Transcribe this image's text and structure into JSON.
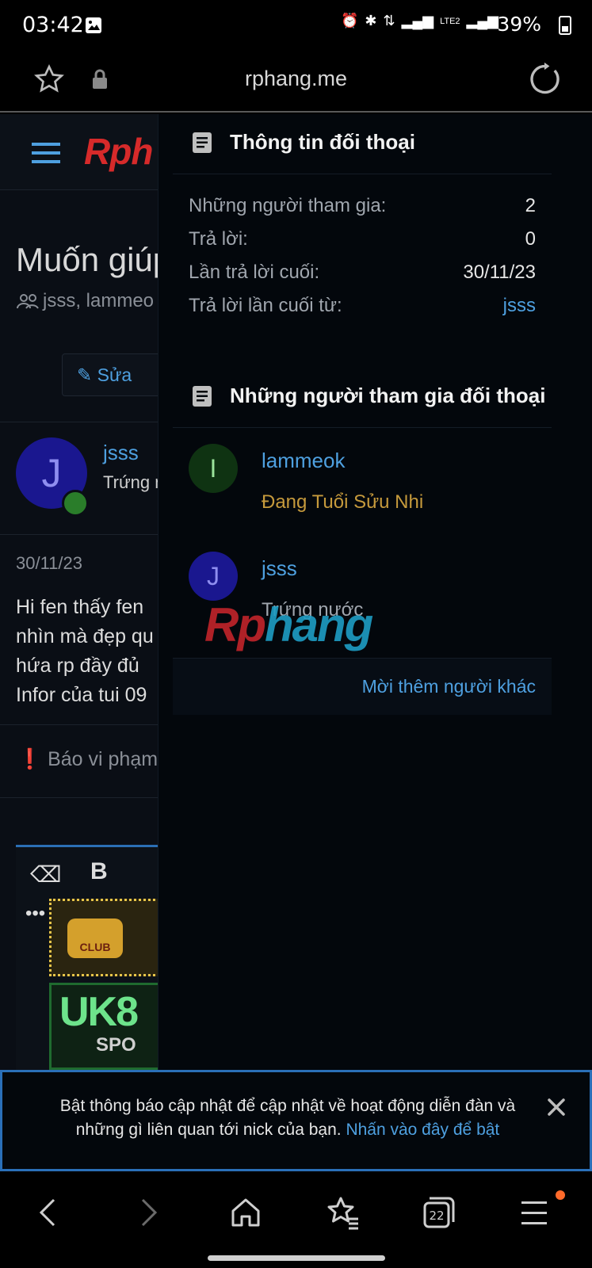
{
  "status_bar": {
    "time": "03:42",
    "battery": "39%"
  },
  "browser": {
    "url": "rphang.me"
  },
  "page": {
    "title": "Muốn giúp",
    "participants_text": "jsss, lammeo",
    "edit_label": "Sửa",
    "author": {
      "initial": "J",
      "name": "jsss",
      "role": "Trứng n"
    },
    "post_date": "30/11/23",
    "message_lines": [
      "Hi fen thấy fen",
      "nhìn mà đẹp qu",
      "hứa rp đầy đủ",
      "Infor của tui 09"
    ],
    "report_label": "Báo vi phạm",
    "logo": {
      "part1": "Rph",
      "part2": ""
    },
    "ad_club": "CLUB",
    "ad_uk": "UK8",
    "ad_spo": "SPO"
  },
  "panel": {
    "conversation_info": {
      "title": "Thông tin đối thoại",
      "rows": [
        {
          "label": "Những người tham gia:",
          "value": "2"
        },
        {
          "label": "Trả lời:",
          "value": "0"
        },
        {
          "label": "Lần trả lời cuối:",
          "value": "30/11/23"
        },
        {
          "label": "Trả lời lần cuối từ:",
          "value": "jsss"
        }
      ]
    },
    "participants": {
      "title": "Những người tham gia đối thoại",
      "members": [
        {
          "initial": "I",
          "name": "lammeok",
          "title": "Đang Tuổi Sửu Nhi",
          "avatar_bg": "#0f3312",
          "avatar_fg": "#9be39b",
          "title_color": "#c69a3c"
        },
        {
          "initial": "J",
          "name": "jsss",
          "title": "Trứng nước",
          "avatar_bg": "#1a178f",
          "avatar_fg": "#8f8ef0",
          "title_color": "#a0a6ae"
        }
      ]
    },
    "invite_label": "Mời thêm người khác",
    "watermark": {
      "part1": "Rp",
      "part2": "hang"
    }
  },
  "notification": {
    "text": "Bật thông báo cập nhật để cập nhật về hoạt động diễn đàn và những gì liên quan tới nick của bạn.",
    "link": "Nhấn vào đây để bật"
  },
  "bottom_nav": {
    "tabs_count": "22"
  }
}
